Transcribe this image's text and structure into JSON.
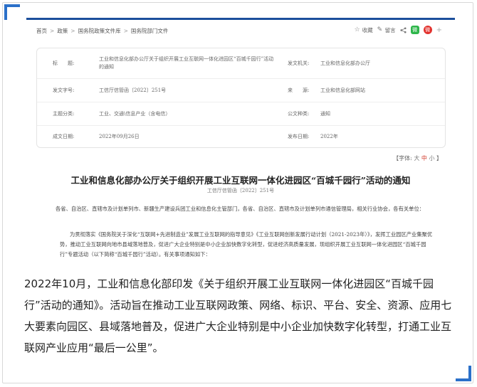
{
  "breadcrumb": [
    "首页",
    "政策",
    "国务院政策文件库",
    "国务院部门文件"
  ],
  "toolbar": {
    "favorite": "收藏",
    "comment": "留言",
    "wechat": "微",
    "weibo": "微",
    "plus": "+"
  },
  "meta": {
    "title_label": "标　　题:",
    "title_value": "工业和信息化部办公厅关于组织开展工业互联网一体化进园区“百城千园行”活动的通知",
    "issuer_label": "发文机关:",
    "issuer_value": "工业和信息化部办公厅",
    "docno_label": "发文字号:",
    "docno_value": "工信厅信管函〔2022〕251号",
    "source_label": "来　　源:",
    "source_value": "工业和信息化部网站",
    "topic_label": "主题分类:",
    "topic_value": "工业、交通\\信息产业（含电信）",
    "doctype_label": "公文种类:",
    "doctype_value": "通知",
    "date_label": "成文日期:",
    "date_value": "2022年09月26日",
    "pubdate_label": "发布日期:",
    "pubdate_value": "2022年"
  },
  "fontsize": {
    "prefix": "【字体:",
    "big": "大",
    "mid": "中",
    "small": "小",
    "suffix": "】"
  },
  "document": {
    "title": "工业和信息化部办公厅关于组织开展工业互联网一体化进园区“百城千园行”活动的通知",
    "number": "工信厅信管函〔2022〕251号",
    "para1": "各省、自治区、直辖市及计划单列市、新疆生产建设兵团工业和信息化主管部门，各省、自治区、直辖市及计划单列市通信管理局，相关行业协会，各有关单位：",
    "para2": "为贯彻落实《国务院关于深化“互联网+先进制造业”发展工业互联网的指导意见》《工业互联网创新发展行动计划（2021-2023年）》，发挥工业园区产业集聚优势，推动工业互联网向地市县域落地普及，促进广大企业特别是中小企业加快数字化转型，促进经济高质量发展，现组织开展工业互联网一体化进园区“百城千园行”专题活动（以下简称“百城千园行”活动）。有关事项通知如下："
  },
  "caption": "2022年10月，工业和信息化部印发《关于组织开展工业互联网一体化进园区“百城千园行”活动的通知》。活动旨在推动工业互联网政策、网络、标识、平台、安全、资源、应用七大要素向园区、县域落地普及，促进广大企业特别是中小企业加快数字化转型，打通工业互联网产业应用“最后一公里”。",
  "colors": {
    "accent_blue": "#2b70c9",
    "header_line": "#1c4f9c",
    "wechat_green": "#2fb64b",
    "weibo_red": "#e2312d",
    "font_mid_red": "#d23a2a"
  }
}
